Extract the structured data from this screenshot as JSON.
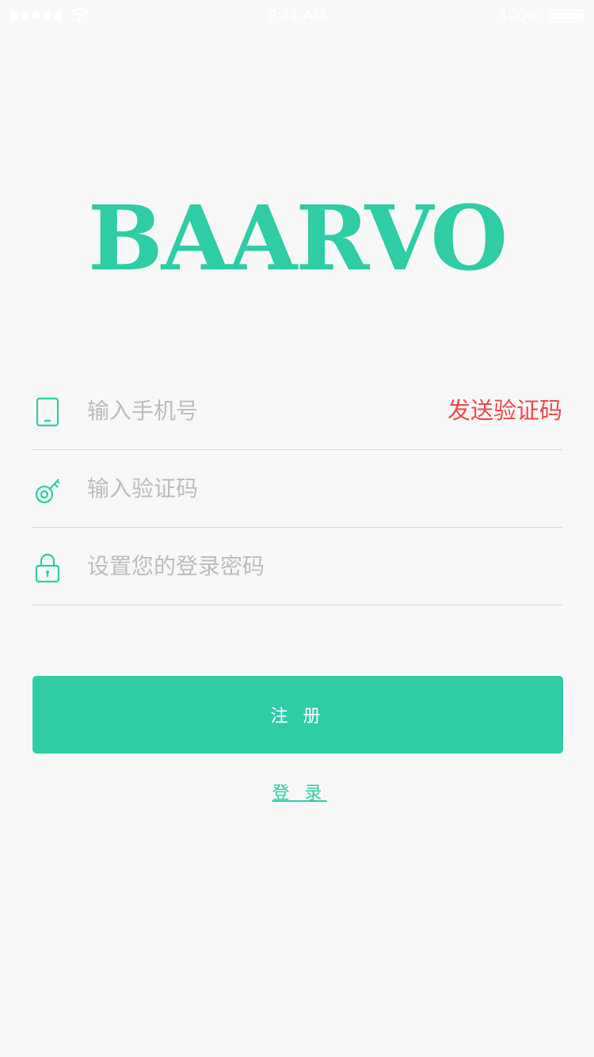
{
  "status_bar": {
    "time": "9:41 AM",
    "battery": "100%"
  },
  "brand": {
    "logo": "BAARVO",
    "color": "#2ecda6"
  },
  "form": {
    "phone_placeholder": "输入手机号",
    "send_code": "发送验证码",
    "code_placeholder": "输入验证码",
    "password_placeholder": "设置您的登录密码"
  },
  "actions": {
    "register": "注 册",
    "login": "登 录"
  },
  "colors": {
    "accent": "#2ecda6",
    "warning": "#f04848",
    "placeholder": "#bcbcbc"
  }
}
